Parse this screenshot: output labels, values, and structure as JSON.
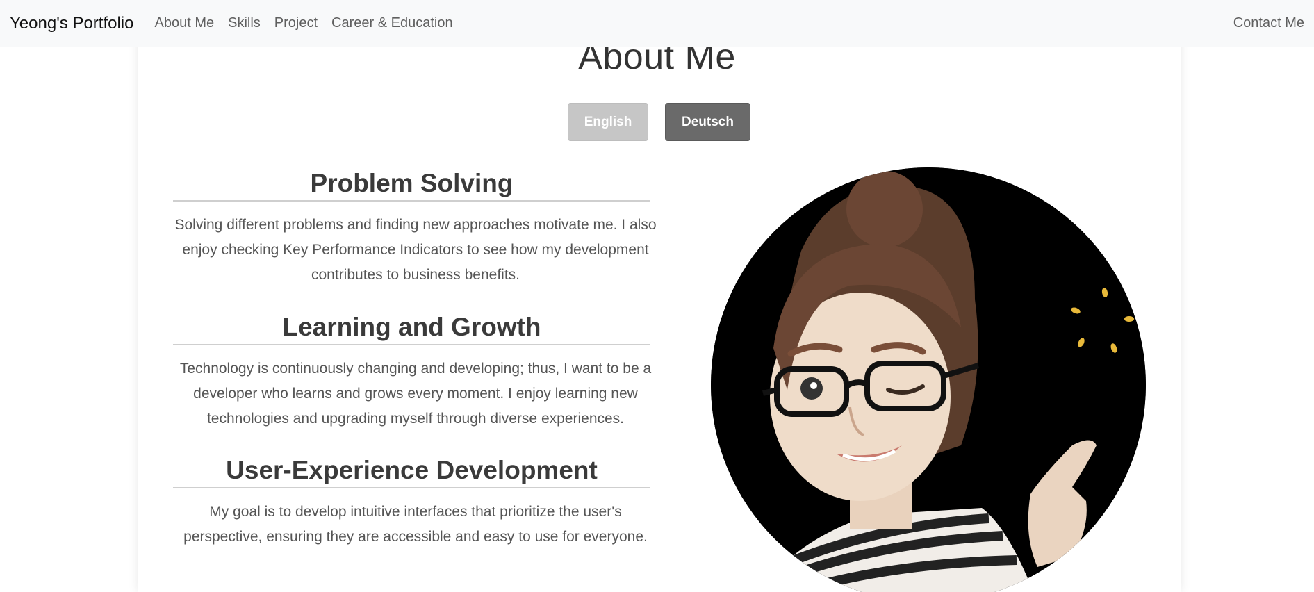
{
  "navbar": {
    "brand": "Yeong's Portfolio",
    "links": [
      "About Me",
      "Skills",
      "Project",
      "Career & Education"
    ],
    "contact": "Contact Me"
  },
  "page": {
    "title": "About Me"
  },
  "language": {
    "english": "English",
    "deutsch": "Deutsch"
  },
  "sections": [
    {
      "title": "Problem Solving",
      "text": "Solving different problems and finding new approaches motivate me. I also enjoy checking Key Performance Indicators to see how my development contributes to business benefits."
    },
    {
      "title": "Learning and Growth",
      "text": "Technology is continuously changing and developing; thus, I want to be a developer who learns and grows every moment. I enjoy learning new technologies and upgrading myself through diverse experiences."
    },
    {
      "title": "User-Experience Development",
      "text": "My goal is to develop intuitive interfaces that prioritize the user's perspective, ensuring they are accessible and easy to use for everyone."
    }
  ]
}
